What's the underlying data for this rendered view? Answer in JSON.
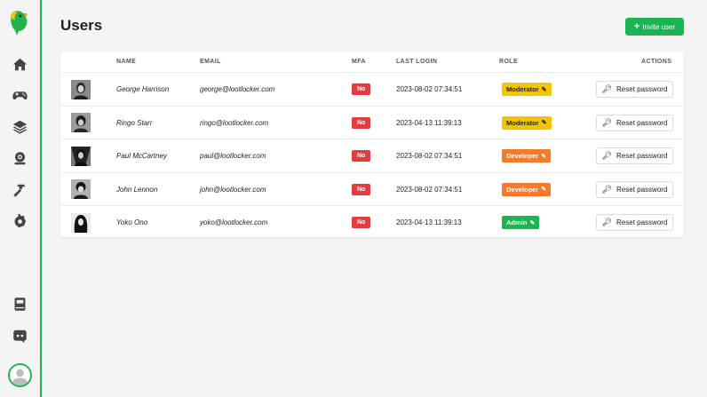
{
  "page": {
    "title": "Users"
  },
  "toolbar": {
    "invite_label": "Invite user"
  },
  "table": {
    "headers": {
      "name": "NAME",
      "email": "EMAIL",
      "mfa": "MFA",
      "last_login": "LAST LOGIN",
      "role": "ROLE",
      "actions": "ACTIONS"
    },
    "rows": [
      {
        "name": "George Harrison",
        "email": "george@lootlocker.com",
        "mfa": "No",
        "last_login": "2023-08-02 07:34:51",
        "role": "Moderator",
        "action": "Reset password"
      },
      {
        "name": "Ringo Starr",
        "email": "ringo@lootlocker.com",
        "mfa": "No",
        "last_login": "2023-04-13 11:39:13",
        "role": "Moderator",
        "action": "Reset password"
      },
      {
        "name": "Paul McCartney",
        "email": "paul@lootlocker.com",
        "mfa": "No",
        "last_login": "2023-08-02 07:34:51",
        "role": "Developer",
        "action": "Reset password"
      },
      {
        "name": "John Lennon",
        "email": "john@lootlocker.com",
        "mfa": "No",
        "last_login": "2023-08-02 07:34:51",
        "role": "Developer",
        "action": "Reset password"
      },
      {
        "name": "Yoko Ono",
        "email": "yoko@lootlocker.com",
        "mfa": "No",
        "last_login": "2023-04-13 11:39:13",
        "role": "Admin",
        "action": "Reset password"
      }
    ]
  },
  "sidebar": {
    "icons": [
      "home-icon",
      "gamepad-icon",
      "layers-icon",
      "webcam-icon",
      "hammer-icon",
      "gear-icon",
      "book-icon",
      "discord-icon"
    ]
  },
  "colors": {
    "accent": "#22b24c",
    "danger": "#e23c3c",
    "moderator": "#f5c400",
    "developer": "#f57a2c",
    "admin": "#17b84f"
  }
}
